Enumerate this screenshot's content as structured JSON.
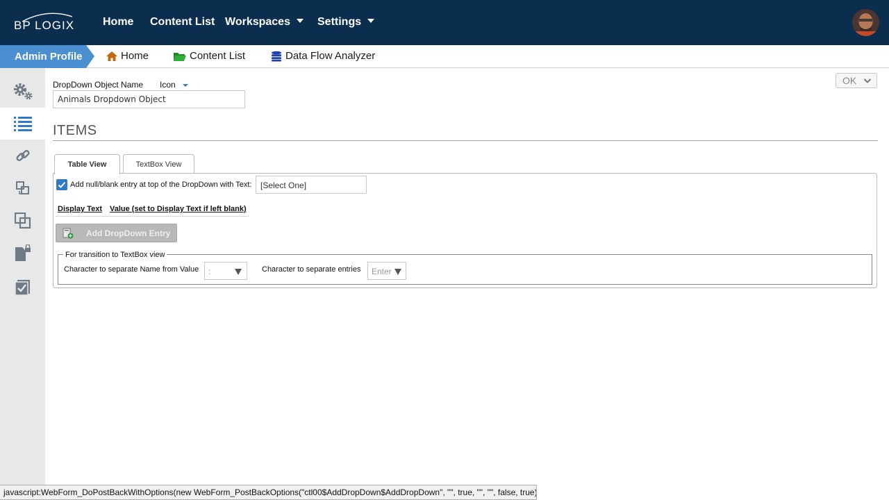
{
  "app": {
    "logo_text": "BP LOGIX",
    "colors": {
      "topbar": "#0b2d4e",
      "accent": "#4a8fd0",
      "sidebar": "#e8e8e8"
    }
  },
  "topnav": {
    "items": [
      {
        "label": "Home"
      },
      {
        "label": "Content List"
      },
      {
        "label": "Workspaces",
        "icon": "chevron-down-icon"
      },
      {
        "label": "Settings",
        "icon": "chevron-down-icon"
      }
    ],
    "avatar": "user-avatar"
  },
  "subnav": {
    "admin_label": "Admin Profile",
    "items": [
      {
        "label": "Home",
        "icon": "house-icon"
      },
      {
        "label": "Content List",
        "icon": "folder-icon"
      },
      {
        "label": "Data Flow Analyzer",
        "icon": "database-icon"
      }
    ]
  },
  "sidebar": {
    "items": [
      {
        "icon": "gears-icon",
        "active": false
      },
      {
        "icon": "list-icon",
        "active": true
      },
      {
        "icon": "link-icon",
        "active": false
      },
      {
        "icon": "move-icon",
        "active": false
      },
      {
        "icon": "copy-icon",
        "active": false
      },
      {
        "icon": "lock-file-icon",
        "active": false
      },
      {
        "icon": "checklist-icon",
        "active": false
      }
    ]
  },
  "form": {
    "object_name_label": "DropDown Object Name",
    "icon_label": "Icon",
    "object_name_value": "Animals Dropdown Object",
    "ok_label": "OK",
    "section_title": "ITEMS",
    "tabs": [
      {
        "label": "Table View",
        "active": true
      },
      {
        "label": "TextBox View",
        "active": false
      }
    ],
    "null_entry": {
      "checked": true,
      "label": "Add null/blank entry at top of the DropDown with Text:",
      "value": "[Select One]"
    },
    "columns": [
      {
        "label": "Display Text"
      },
      {
        "label": "Value (set to Display Text if left blank)"
      }
    ],
    "add_button_label": "Add DropDown Entry",
    "transition": {
      "legend": "For transition to TextBox view",
      "name_value_label": "Character to separate Name from Value",
      "name_value_selected": ":",
      "entries_label": "Character to separate entries",
      "entries_selected": "Enter"
    }
  },
  "statusbar": {
    "text": "javascript:WebForm_DoPostBackWithOptions(new WebForm_PostBackOptions(\"ctl00$AddDropDown$AddDropDown\", \"\", true, \"\", \"\", false, true))"
  }
}
